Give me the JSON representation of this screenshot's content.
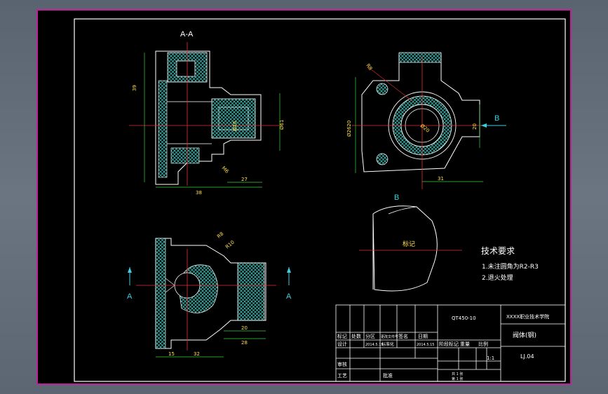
{
  "views": {
    "section_label": "A-A",
    "view_b_label": "B",
    "arrow_b": "B",
    "cut_arrow_left": "A",
    "cut_arrow_right": "A",
    "part_note": "标记"
  },
  "dims": {
    "d_height_left": "39",
    "d_bore": "Ø26",
    "d_od_right": "Ø61",
    "d_thread": "M6",
    "d_width_total": "38",
    "d_right_len": "27",
    "d_top_r": "R8",
    "d_circle": "Ø20",
    "d_side_height": "Ø2620",
    "d_side_right": "20",
    "d_side_bottom": "31",
    "d_bottom_r1": "R8",
    "d_bottom_r2": "R10",
    "d_bottom_a": "20",
    "d_bottom_b": "28",
    "d_bottom_c": "15",
    "d_bottom_d": "32"
  },
  "tech_req": {
    "title": "技术要求",
    "item1": "1.未注圆角为R2-R3",
    "item2": "2.退火处理"
  },
  "title_block": {
    "material": "QT450-10",
    "school": "XXXX职业技术学院",
    "part_name": "阀体(钢)",
    "drawing_no": "LJ.04",
    "scale": "1:1",
    "hdr_mark": "标记",
    "hdr_count": "处数",
    "hdr_zone": "分区",
    "hdr_doc": "更改文件号",
    "hdr_sign": "签名",
    "hdr_date": "日期",
    "row_design": "设计",
    "row_date1": "2014.5.15",
    "row_std": "标准化",
    "row_date2": "2014.5.15",
    "row_stage": "阶段标记",
    "row_weight": "重量",
    "row_ratio": "比例",
    "row_check": "审核",
    "row_process": "工艺",
    "row_approve": "批准",
    "sheet_total": "共 1 张",
    "sheet_no": "第 1 张"
  }
}
